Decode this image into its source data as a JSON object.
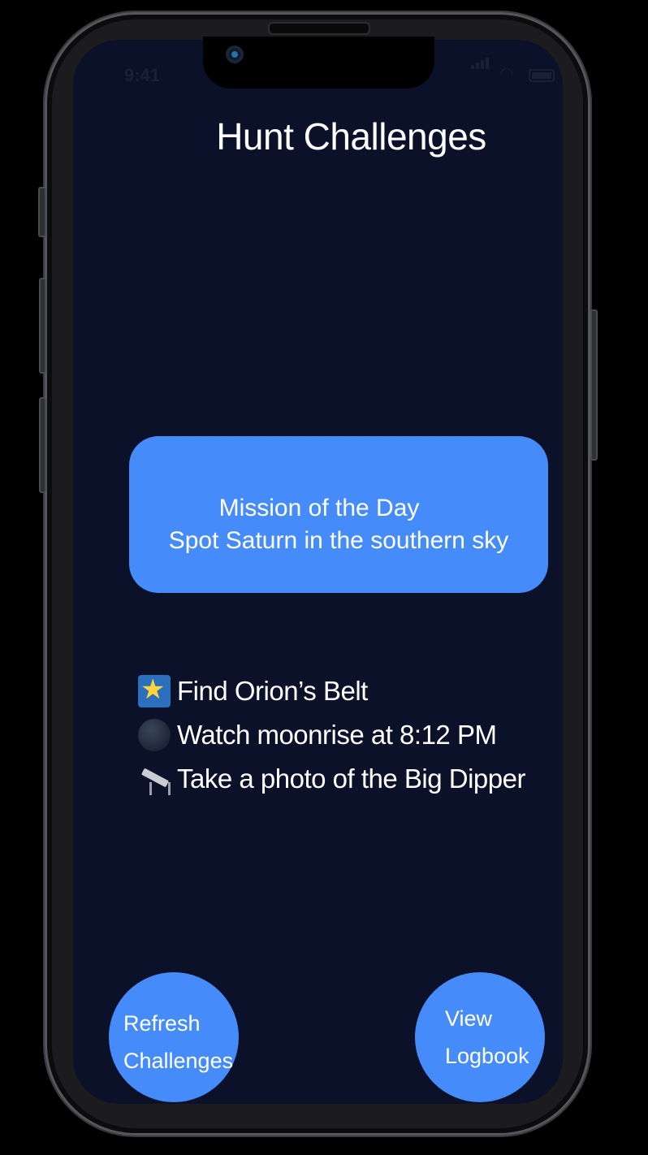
{
  "status_bar": {
    "time": "9:41"
  },
  "header": {
    "title": "Hunt Challenges"
  },
  "mission": {
    "heading": "Mission of the Day",
    "text": "Spot Saturn in the southern sky"
  },
  "challenges": [
    {
      "icon": "shooting-star-icon",
      "label": "Find Orion’s Belt"
    },
    {
      "icon": "moon-icon",
      "label": "Watch moonrise at 8:12 PM"
    },
    {
      "icon": "telescope-icon",
      "label": "Take a photo of the Big Dipper"
    }
  ],
  "buttons": {
    "refresh": {
      "line1": "Refresh",
      "line2": "Challenges"
    },
    "logbook": {
      "line1": "View",
      "line2": "Logbook"
    }
  },
  "colors": {
    "background": "#0b1128",
    "accent": "#458cfa",
    "text": "#ffffff"
  }
}
